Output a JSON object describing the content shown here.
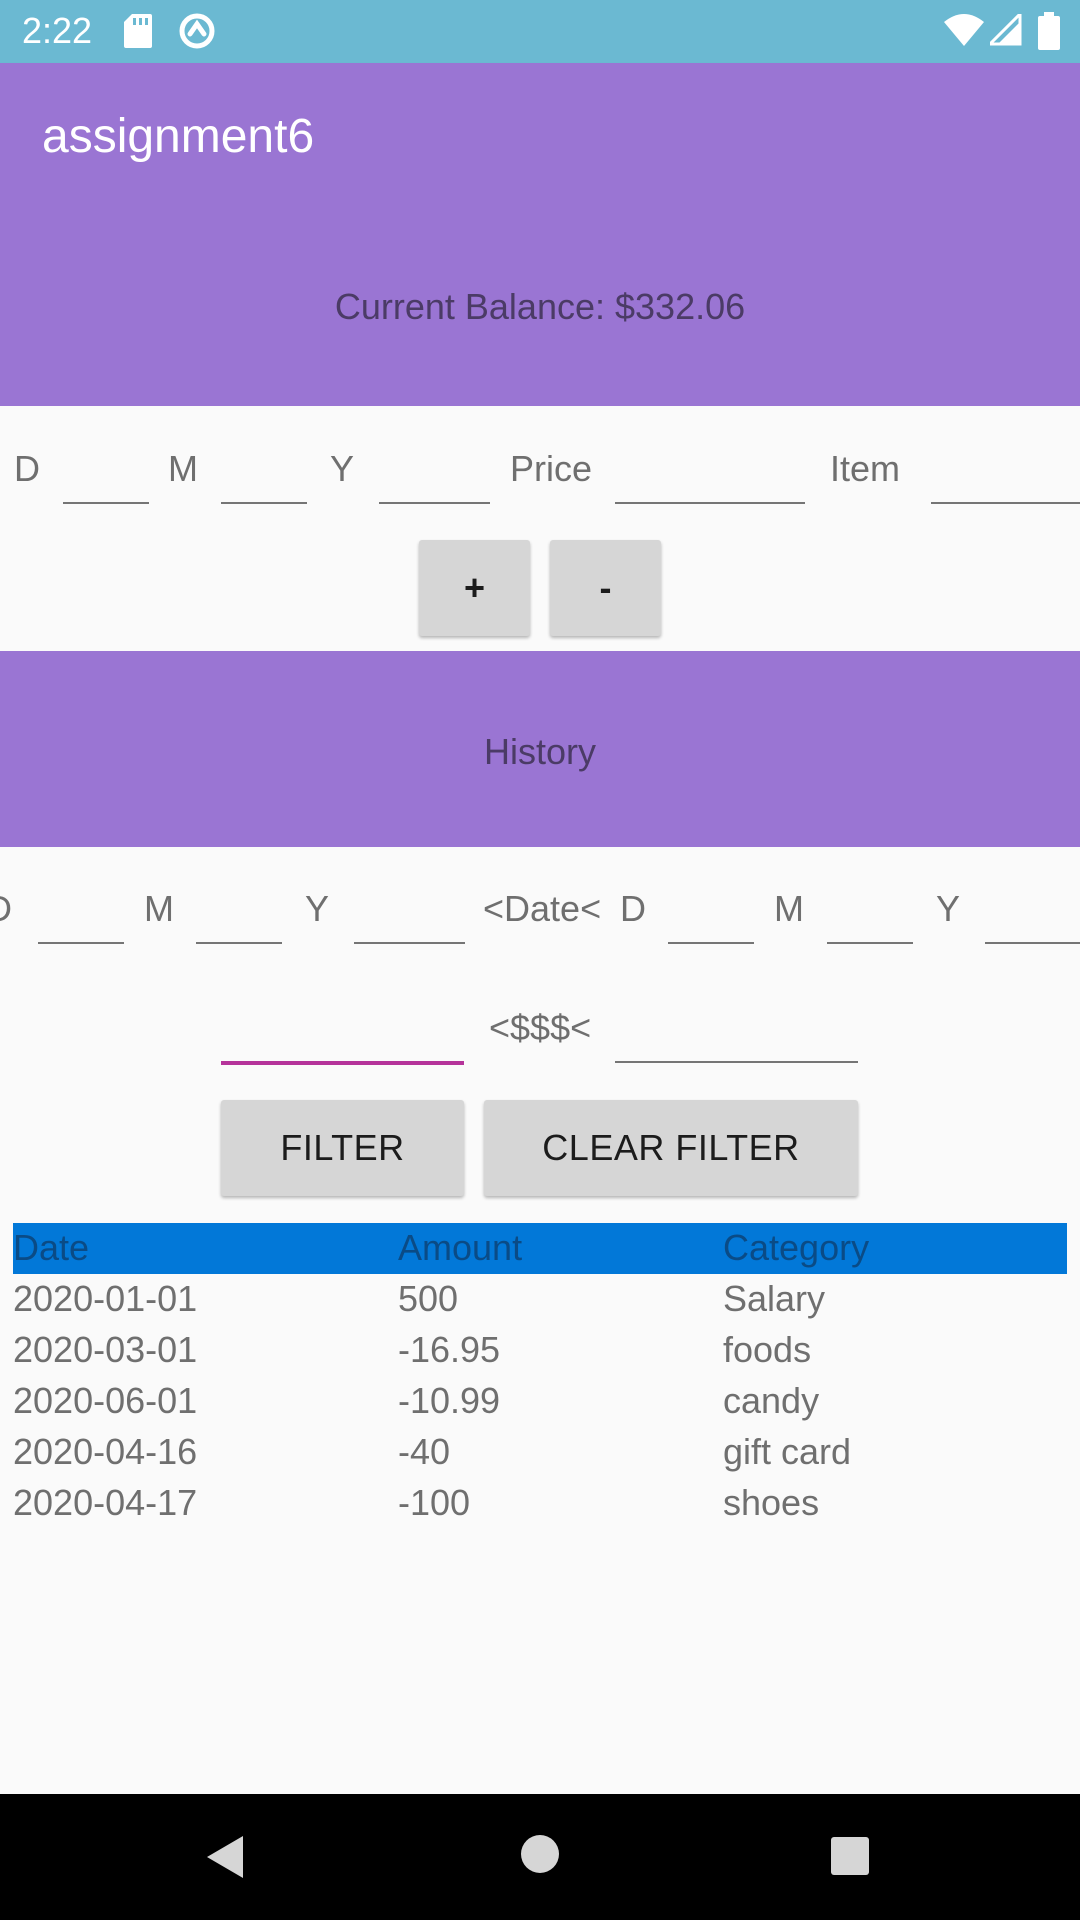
{
  "status_bar": {
    "time": "2:22",
    "icons": [
      "sd-card-icon",
      "sync-icon",
      "wifi-icon",
      "signal-icon",
      "battery-icon"
    ]
  },
  "app_bar": {
    "title": "assignment6"
  },
  "balance": {
    "text": "Current Balance: $332.06"
  },
  "entry_form": {
    "day_label": "D",
    "month_label": "M",
    "year_label": "Y",
    "price_label": "Price",
    "item_label": "Item",
    "add_button": "+",
    "subtract_button": "-"
  },
  "history": {
    "title": "History"
  },
  "filter": {
    "from_day_label": "D",
    "from_month_label": "M",
    "from_year_label": "Y",
    "date_separator": "<Date<",
    "to_day_label": "D",
    "to_month_label": "M",
    "to_year_label": "Y",
    "amount_separator": "<$$$<",
    "filter_button": "FILTER",
    "clear_button": "CLEAR FILTER"
  },
  "table": {
    "headers": [
      "Date",
      "Amount",
      "Category"
    ],
    "rows": [
      [
        "2020-01-01",
        "500",
        "Salary"
      ],
      [
        "2020-03-01",
        "-16.95",
        "foods"
      ],
      [
        "2020-06-01",
        "-10.99",
        "candy"
      ],
      [
        "2020-04-16",
        "-40",
        "gift card"
      ],
      [
        "2020-04-17",
        "-100",
        "shoes"
      ]
    ]
  },
  "colors": {
    "status_bar": "#6bb9d2",
    "primary": "#9a75d3",
    "table_header": "#0278d8",
    "active_underline": "#b5339a"
  },
  "nav_bar": {
    "icons": [
      "back-icon",
      "home-icon",
      "recents-icon"
    ]
  }
}
